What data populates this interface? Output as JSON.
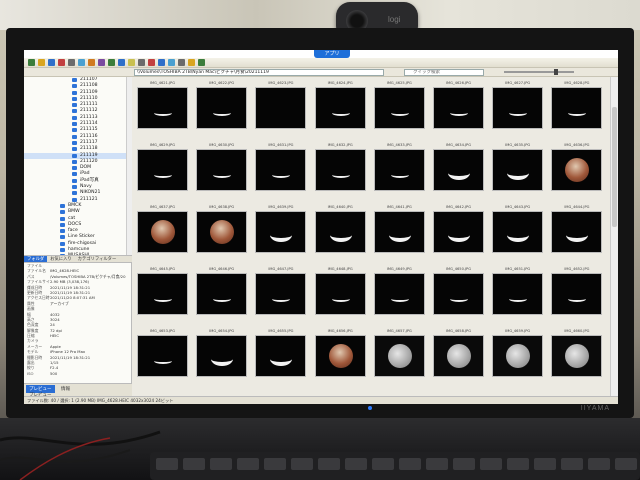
{
  "webcam": {
    "brand": "logi"
  },
  "monitor": {
    "brand": "IIYAMA"
  },
  "app": {
    "window_tab_label": "アプリ",
    "address": "\\\\Volumes\\TOSHIBA 2TB\\Nyan Mac\\ピクチャ\\月食\\20211119",
    "search_placeholder": "クイック検索"
  },
  "sidebar": {
    "folders": [
      {
        "label": "211107",
        "indent": 0,
        "selected": false
      },
      {
        "label": "211108",
        "indent": 0,
        "selected": false
      },
      {
        "label": "211109",
        "indent": 0,
        "selected": false
      },
      {
        "label": "211110",
        "indent": 0,
        "selected": false
      },
      {
        "label": "211111",
        "indent": 0,
        "selected": false
      },
      {
        "label": "211112",
        "indent": 0,
        "selected": false
      },
      {
        "label": "211113",
        "indent": 0,
        "selected": false
      },
      {
        "label": "211114",
        "indent": 0,
        "selected": false
      },
      {
        "label": "211115",
        "indent": 0,
        "selected": false
      },
      {
        "label": "211116",
        "indent": 0,
        "selected": false
      },
      {
        "label": "211117",
        "indent": 0,
        "selected": false
      },
      {
        "label": "211118",
        "indent": 0,
        "selected": false
      },
      {
        "label": "211119",
        "indent": 0,
        "selected": true
      },
      {
        "label": "211120",
        "indent": 0,
        "selected": false
      },
      {
        "label": "DOM",
        "indent": 0,
        "selected": false
      },
      {
        "label": "iPad",
        "indent": 0,
        "selected": false
      },
      {
        "label": "iPad写真",
        "indent": 0,
        "selected": false
      },
      {
        "label": "Navy",
        "indent": 0,
        "selected": false
      },
      {
        "label": "NIKON21",
        "indent": 0,
        "selected": false
      },
      {
        "label": "211121",
        "indent": 0,
        "selected": false
      },
      {
        "label": "BMCK",
        "indent": 1,
        "selected": false
      },
      {
        "label": "BMW",
        "indent": 1,
        "selected": false
      },
      {
        "label": "cat",
        "indent": 1,
        "selected": false
      },
      {
        "label": "DOCS",
        "indent": 1,
        "selected": false
      },
      {
        "label": "face",
        "indent": 1,
        "selected": false
      },
      {
        "label": "Line Sticker",
        "indent": 1,
        "selected": false
      },
      {
        "label": "fire-chigosai",
        "indent": 1,
        "selected": false
      },
      {
        "label": "hamcune",
        "indent": 1,
        "selected": false
      },
      {
        "label": "MUSASHI",
        "indent": 1,
        "selected": false
      },
      {
        "label": "tatsu2",
        "indent": 1,
        "selected": false
      }
    ],
    "panel_tabs": [
      {
        "label": "フォルダ",
        "active": true
      },
      {
        "label": "お気に入り",
        "active": false
      },
      {
        "label": "カテゴリフィルター",
        "active": false
      }
    ],
    "properties": [
      {
        "key": "ファイル",
        "value": ""
      },
      {
        "key": "ファイル名",
        "value": "IMG_4628.HEIC"
      },
      {
        "key": "パス",
        "value": "/Volumes/TOSHIBA 2TB/ピクチャ/月食/20"
      },
      {
        "key": "ファイルサイズ",
        "value": "2.90 MB (3,038,176)"
      },
      {
        "key": "作成日時",
        "value": "2021/11/19 18:31:21"
      },
      {
        "key": "更新日時",
        "value": "2021/11/19 18:31:21"
      },
      {
        "key": "アクセス日時",
        "value": "2021/11/20 8:07:31 AM"
      },
      {
        "key": "属性",
        "value": "アーカイブ"
      },
      {
        "key": "画像",
        "value": ""
      },
      {
        "key": "幅",
        "value": "4032"
      },
      {
        "key": "高さ",
        "value": "3024"
      },
      {
        "key": "色深度",
        "value": "24"
      },
      {
        "key": "解像度",
        "value": "72 dpi"
      },
      {
        "key": "圧縮",
        "value": "HEIC"
      },
      {
        "key": "カメラ",
        "value": ""
      },
      {
        "key": "メーカー",
        "value": "Apple"
      },
      {
        "key": "モデル",
        "value": "iPhone 12 Pro Max"
      },
      {
        "key": "撮影日時",
        "value": "2021/11/19 18:31:21"
      },
      {
        "key": "露出",
        "value": "1/15"
      },
      {
        "key": "絞り",
        "value": "F2.4"
      },
      {
        "key": "ISO",
        "value": "500"
      }
    ],
    "bottom_tabs": [
      {
        "label": "プレビュー",
        "active": true
      },
      {
        "label": "情報",
        "active": false
      },
      {
        "label": "プレビュー",
        "active": false
      }
    ]
  },
  "thumbnails": {
    "rows": [
      [
        "IMG_4621.JPG",
        "IMG_4622.JPG",
        "IMG_4623.JPG",
        "IMG_4624.JPG",
        "IMG_4625.JPG",
        "IMG_4626.JPG",
        "IMG_4627.JPG",
        "IMG_4628.JPG"
      ],
      [
        "IMG_4629.JPG",
        "IMG_4630.JPG",
        "IMG_4631.JPG",
        "IMG_4632.JPG",
        "IMG_4633.JPG",
        "IMG_4634.JPG",
        "IMG_4635.JPG",
        "IMG_4636.JPG"
      ],
      [
        "IMG_4637.JPG",
        "IMG_4638.JPG",
        "IMG_4639.JPG",
        "IMG_4640.JPG",
        "IMG_4641.JPG",
        "IMG_4642.JPG",
        "IMG_4643.JPG",
        "IMG_4644.JPG"
      ],
      [
        "IMG_4645.JPG",
        "IMG_4646.JPG",
        "IMG_4647.JPG",
        "IMG_4648.JPG",
        "IMG_4649.JPG",
        "IMG_4650.JPG",
        "IMG_4651.JPG",
        "IMG_4652.JPG"
      ],
      [
        "IMG_4653.JPG",
        "IMG_4654.JPG",
        "IMG_4655.JPG",
        "IMG_4656.JPG",
        "IMG_4657.JPG",
        "IMG_4658.JPG",
        "IMG_4659.JPG",
        "IMG_4660.JPG"
      ]
    ],
    "phases": [
      [
        "thin",
        "thin",
        "dark",
        "thin",
        "thin",
        "thin",
        "thin",
        "thin"
      ],
      [
        "thin",
        "thin",
        "thin",
        "thin",
        "thin",
        "crescent",
        "crescent",
        "red"
      ],
      [
        "red",
        "red",
        "crescent",
        "crescent",
        "crescent",
        "crescent",
        "crescent",
        "crescent"
      ],
      [
        "thin",
        "thin",
        "thin",
        "thin",
        "thin",
        "thin",
        "thin",
        "thin"
      ],
      [
        "thin",
        "crescent",
        "crescent",
        "red",
        "full",
        "full",
        "full",
        "full"
      ]
    ]
  },
  "status": {
    "text": "ファイル数: 40 / 選択: 1 (2.90 MB)   IMG_4628.HEIC  4032x3024  24ビット"
  }
}
